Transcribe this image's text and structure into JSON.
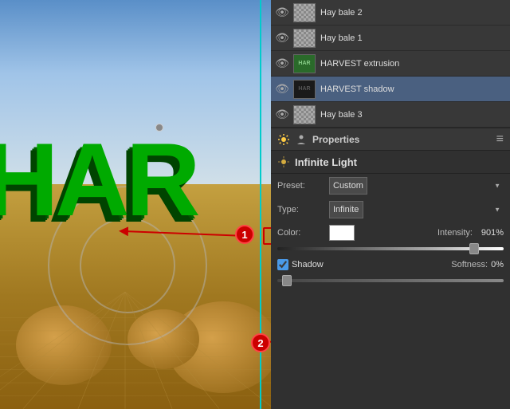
{
  "layers": {
    "items": [
      {
        "id": 1,
        "name": "Hay bale 2",
        "type": "image",
        "visible": true,
        "active": false
      },
      {
        "id": 2,
        "name": "Hay bale 1",
        "type": "image",
        "visible": true,
        "active": false
      },
      {
        "id": 3,
        "name": "HARVEST extrusion",
        "type": "text",
        "visible": true,
        "active": false
      },
      {
        "id": 4,
        "name": "HARVEST shadow",
        "type": "text",
        "visible": true,
        "active": true
      },
      {
        "id": 5,
        "name": "Hay bale 3",
        "type": "image",
        "visible": true,
        "active": false
      }
    ]
  },
  "properties": {
    "section_label": "Properties",
    "light_title": "Infinite Light",
    "preset_label": "Preset:",
    "preset_value": "Custom",
    "type_label": "Type:",
    "type_value": "Infinite",
    "color_label": "Color:",
    "intensity_label": "Intensity:",
    "intensity_value": "901%",
    "shadow_label": "Shadow",
    "softness_label": "Softness:",
    "softness_value": "0%"
  },
  "badges": [
    {
      "id": "badge-1",
      "label": "1",
      "description": "Shadow checkbox annotation"
    },
    {
      "id": "badge-2",
      "label": "2",
      "description": "Teal line annotation"
    }
  ],
  "canvas_text": "HAR",
  "colors": {
    "active_layer_bg": "#4a6080",
    "panel_bg": "#383838",
    "properties_bg": "#303030",
    "accent_red": "#cc0000",
    "accent_teal": "#00cccc"
  }
}
